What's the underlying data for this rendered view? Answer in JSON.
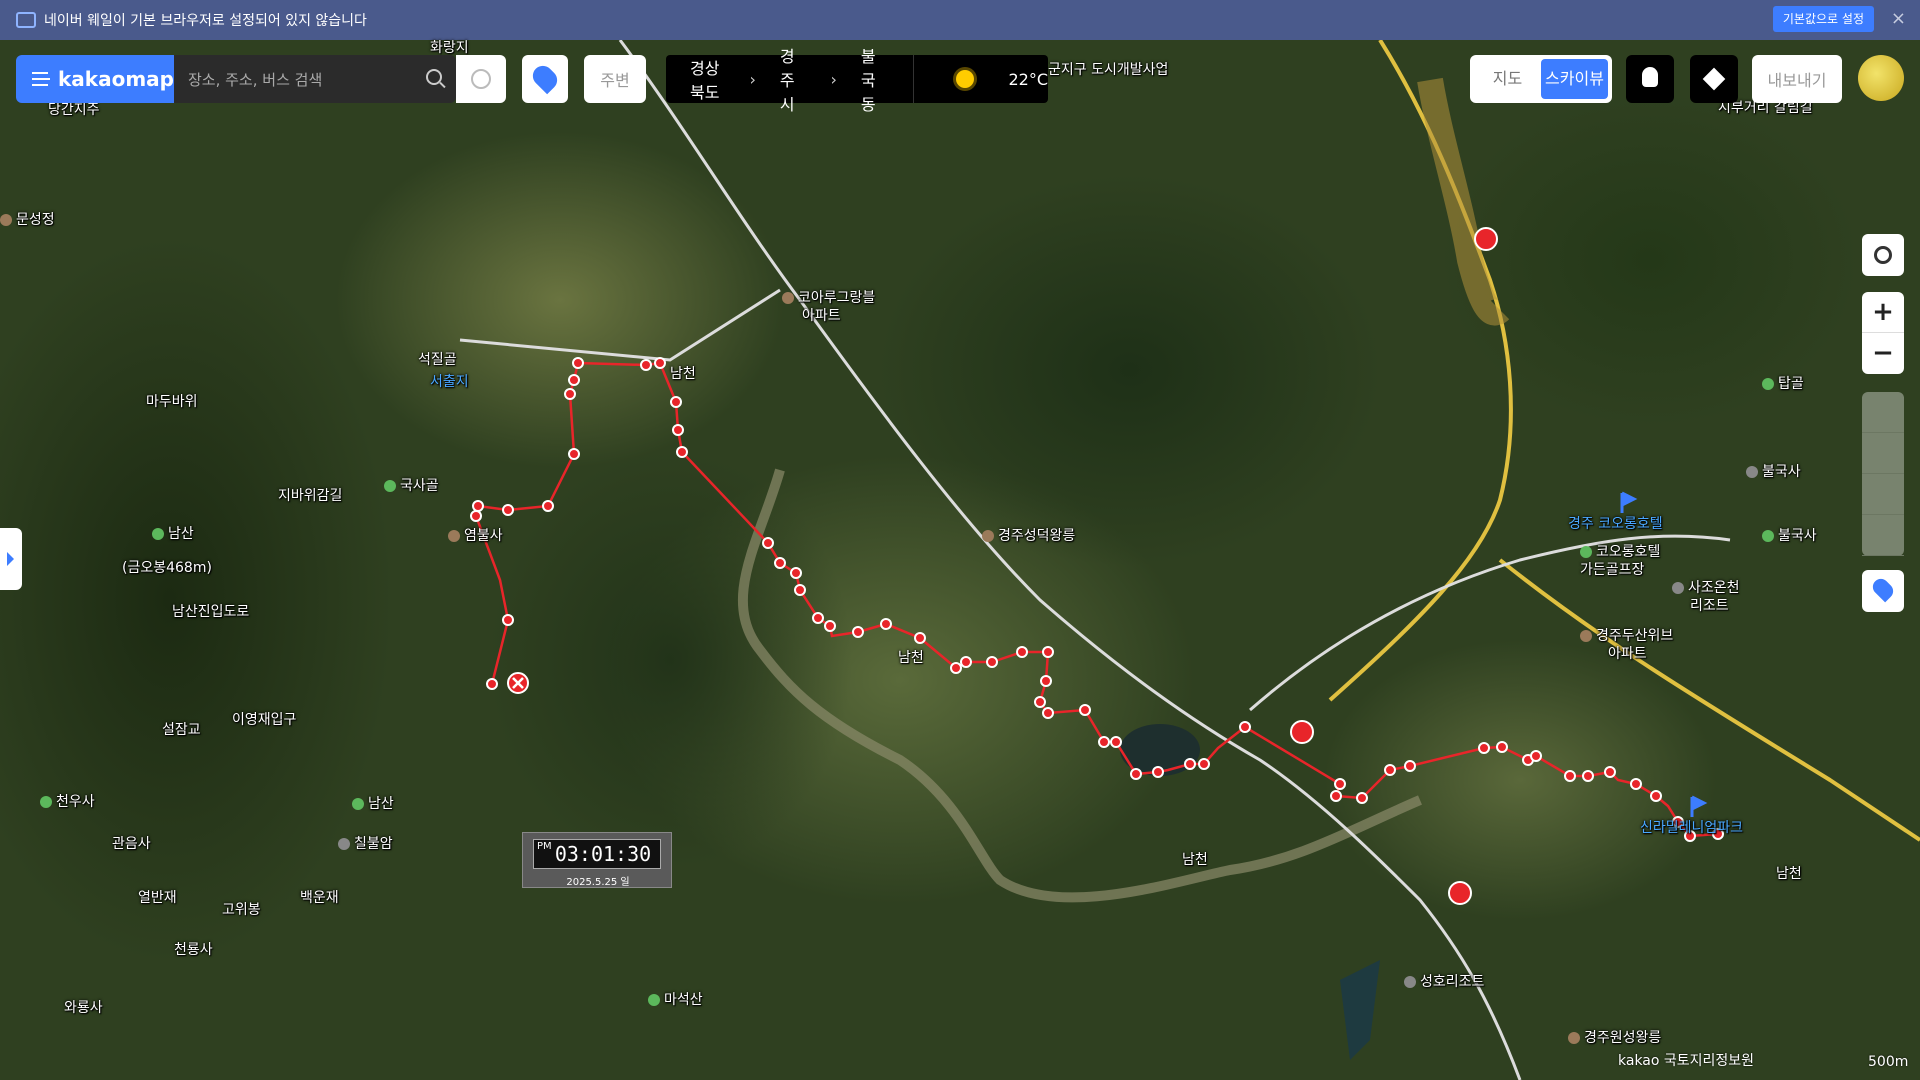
{
  "notice": {
    "text": "네이버 웨일이 기본 브라우저로 설정되어 있지 않습니다",
    "button": "기본값으로 설정",
    "close": "×"
  },
  "toolbar": {
    "brand": "kakaomap",
    "search_placeholder": "장소, 주소, 버스 검색",
    "nearby": "주변",
    "breadcrumb": [
      "경상북도",
      "경주시",
      "불국동"
    ],
    "weather_temp": "22°C",
    "map_type": [
      "지도",
      "스카이뷰"
    ],
    "map_type_selected": "스카이뷰",
    "export": "내보내기"
  },
  "controls": {
    "zoom_in": "+",
    "zoom_out": "−"
  },
  "clock": {
    "ampm": "PM",
    "time": "03:01:30",
    "date": "2025.5.25 일"
  },
  "places": [
    "당간지주",
    "문성정",
    "서출지",
    "화랑지",
    "석질골",
    "마두바위",
    "국사골",
    "지바위감길",
    "남산",
    "(금오봉468m)",
    "염불사",
    "남산진입도로",
    "이영재입구",
    "설잠교",
    "천우사",
    "관음사",
    "열반재",
    "고위봉",
    "백운재",
    "남산",
    "칠불암",
    "천룡사",
    "와룡사",
    "마석산",
    "코아루그랑블",
    "아파트",
    "경주성덕왕릉",
    "군지구 도시개발사업",
    "시부거리 갈림길",
    "탑골",
    "불국사",
    "불국사",
    "경주 코오롱호텔",
    "코오롱호텔",
    "가든골프장",
    "사조온천",
    "리조트",
    "경주두산위브",
    "아파트",
    "신라밀레니엄파크",
    "성호리조트",
    "경주원성왕릉",
    "남천",
    "남천",
    "남천",
    "남천"
  ],
  "footer": {
    "copyright": "kakao  국토지리정보원",
    "scale": "500m"
  },
  "colors": {
    "accent": "#3d7dff",
    "route": "#e8252a"
  }
}
